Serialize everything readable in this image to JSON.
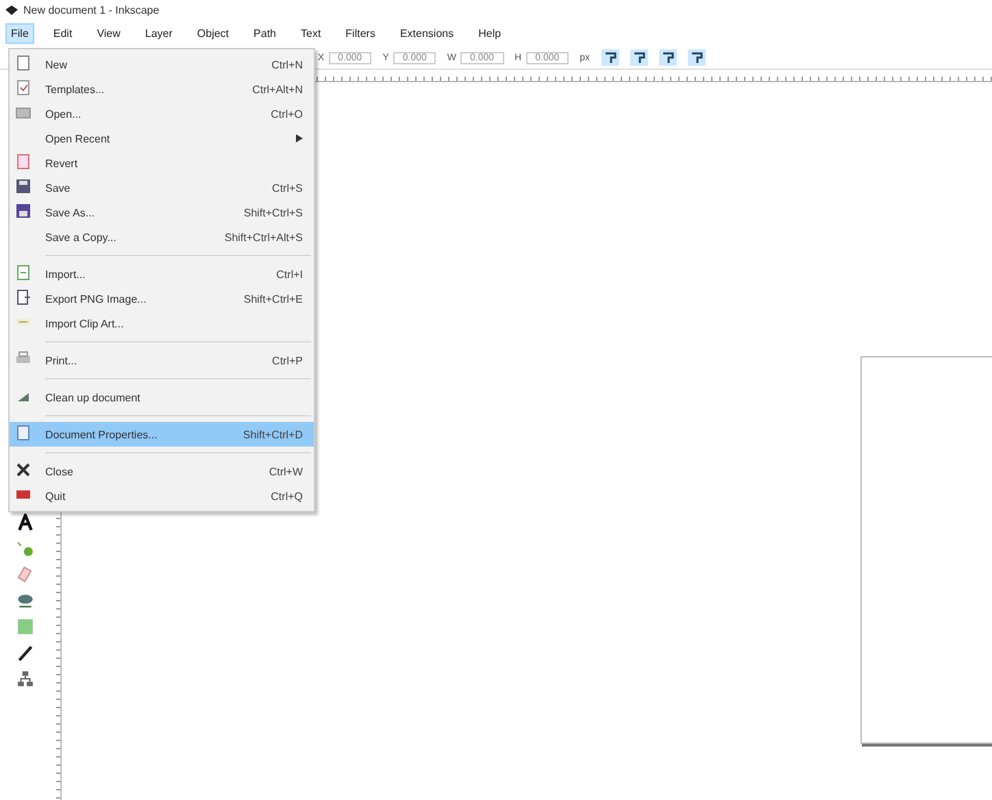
{
  "window": {
    "title": "New document 1 - Inkscape"
  },
  "menubar": [
    {
      "label": "File",
      "selected": true
    },
    {
      "label": "Edit",
      "selected": false
    },
    {
      "label": "View",
      "selected": false
    },
    {
      "label": "Layer",
      "selected": false
    },
    {
      "label": "Object",
      "selected": false
    },
    {
      "label": "Path",
      "selected": false
    },
    {
      "label": "Text",
      "selected": false
    },
    {
      "label": "Filters",
      "selected": false
    },
    {
      "label": "Extensions",
      "selected": false
    },
    {
      "label": "Help",
      "selected": false
    }
  ],
  "toolbar": {
    "fields": [
      {
        "label": "X",
        "value": "0.000"
      },
      {
        "label": "Y",
        "value": "0.000"
      },
      {
        "label": "W",
        "value": "0.000"
      },
      {
        "label": "H",
        "value": "0.000"
      }
    ],
    "unit": "px",
    "snap_buttons": [
      {
        "on": true
      },
      {
        "on": true
      },
      {
        "on": true
      },
      {
        "on": true
      }
    ]
  },
  "file_menu": [
    {
      "kind": "item",
      "label": "New",
      "shortcut": "Ctrl+N",
      "selected": false
    },
    {
      "kind": "item",
      "label": "Templates...",
      "shortcut": "Ctrl+Alt+N",
      "selected": false
    },
    {
      "kind": "item",
      "label": "Open...",
      "shortcut": "Ctrl+O",
      "selected": false
    },
    {
      "kind": "submenu",
      "label": "Open Recent",
      "selected": false
    },
    {
      "kind": "item",
      "label": "Revert",
      "selected": false
    },
    {
      "kind": "item",
      "label": "Save",
      "shortcut": "Ctrl+S",
      "selected": false
    },
    {
      "kind": "item",
      "label": "Save As...",
      "shortcut": "Shift+Ctrl+S",
      "selected": false
    },
    {
      "kind": "item",
      "label": "Save a Copy...",
      "shortcut": "Shift+Ctrl+Alt+S",
      "selected": false
    },
    {
      "kind": "separator"
    },
    {
      "kind": "item",
      "label": "Import...",
      "shortcut": "Ctrl+I",
      "selected": false
    },
    {
      "kind": "item",
      "label": "Export PNG Image...",
      "shortcut": "Shift+Ctrl+E",
      "selected": false
    },
    {
      "kind": "item",
      "label": "Import Clip Art...",
      "selected": false
    },
    {
      "kind": "separator"
    },
    {
      "kind": "item",
      "label": "Print...",
      "shortcut": "Ctrl+P",
      "selected": false
    },
    {
      "kind": "separator"
    },
    {
      "kind": "item",
      "label": "Clean up document",
      "selected": false
    },
    {
      "kind": "separator"
    },
    {
      "kind": "item",
      "label": "Document Properties...",
      "shortcut": "Shift+Ctrl+D",
      "selected": true
    },
    {
      "kind": "separator"
    },
    {
      "kind": "item",
      "label": "Close",
      "shortcut": "Ctrl+W",
      "selected": false
    },
    {
      "kind": "item",
      "label": "Quit",
      "shortcut": "Ctrl+Q",
      "selected": false
    }
  ]
}
